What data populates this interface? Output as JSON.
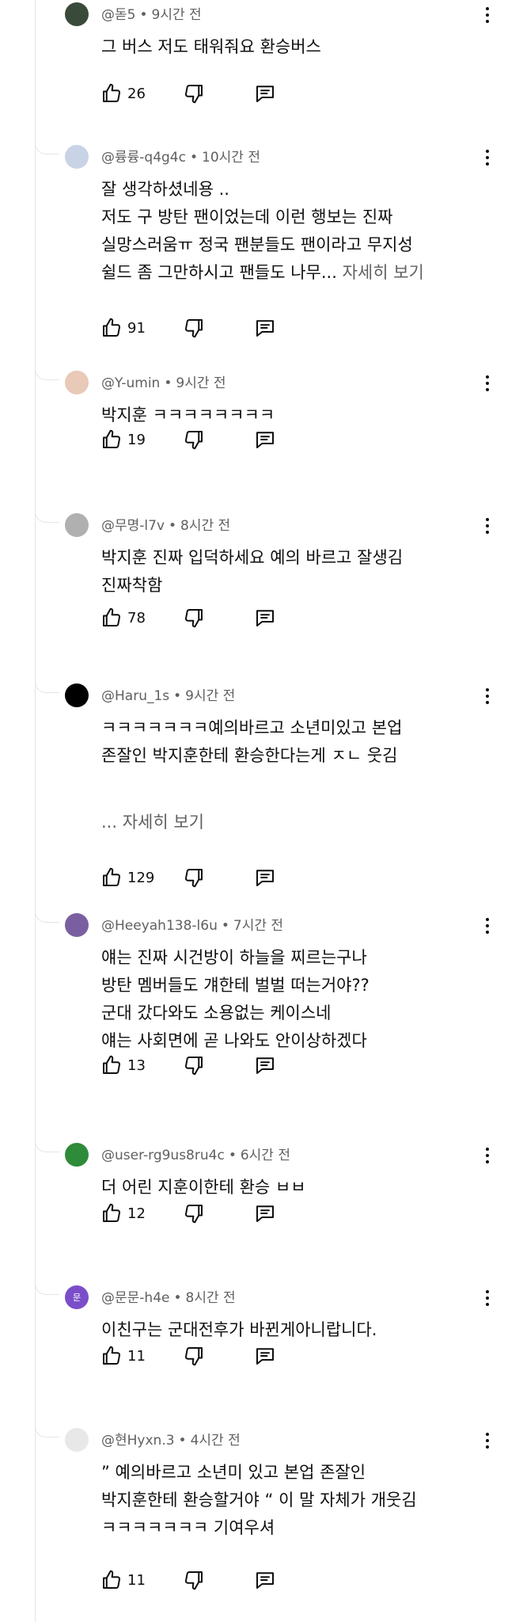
{
  "comments": [
    {
      "author": "@돋5",
      "time": "9시간 전",
      "lines": [
        "그 버스 저도 태워줘요 환승버스"
      ],
      "likes": "26",
      "avatar_color": "#3a4a3a"
    },
    {
      "author": "@륭륭-q4g4c",
      "time": "10시간 전",
      "lines": [
        "잘 생각하셨네용 ..",
        "저도 구 방탄 팬이었는데 이런 행보는 진짜",
        "실망스러움ㅠ 정국 팬분들도 팬이라고 무지성",
        "쉴드 좀 그만하시고 팬들도 나무..."
      ],
      "more": "자세히 보기",
      "likes": "91",
      "avatar_color": "#c9d3e6"
    },
    {
      "author": "@Y-umin",
      "time": "9시간 전",
      "lines": [
        "박지훈 ㅋㅋㅋㅋㅋㅋㅋㅋ"
      ],
      "likes": "19",
      "avatar_color": "#e9c9b8"
    },
    {
      "author": "@무명-l7v",
      "time": "8시간 전",
      "lines": [
        "박지훈 진짜 입덕하세요 예의 바르고 잘생김",
        "진짜착함"
      ],
      "likes": "78",
      "avatar_color": "#b0b0b0"
    },
    {
      "author": "@Haru_1s",
      "time": "9시간 전",
      "lines": [
        "ㅋㅋㅋㅋㅋㅋㅋ예의바르고 소년미있고 본업",
        "존잘인 박지훈한테 환승한다는게 ㅈㄴ 웃김"
      ],
      "more": "... 자세히 보기",
      "likes": "129",
      "avatar_color": "#000000"
    },
    {
      "author": "@Heeyah138-l6u",
      "time": "7시간 전",
      "lines": [
        "얘는 진짜 시건방이 하늘을 찌르는구나",
        "방탄 멤버들도 걔한테 벌벌 떠는거야??",
        "군대 갔다와도 소용없는 케이스네",
        "얘는 사회면에 곧 나와도 안이상하겠다"
      ],
      "likes": "13",
      "avatar_color": "#7a5fa0"
    },
    {
      "author": "@user-rg9us8ru4c",
      "time": "6시간 전",
      "lines": [
        "더 어린 지훈이한테 환승 ㅂㅂ"
      ],
      "likes": "12",
      "avatar_color": "#2e8b3a"
    },
    {
      "author": "@문문-h4e",
      "time": "8시간 전",
      "lines": [
        "이친구는 군대전후가 바뀐게아니랍니다."
      ],
      "likes": "11",
      "avatar_color": "#7b4ec9",
      "avatar_letter": "문"
    },
    {
      "author": "@현Hyxn.3",
      "time": "4시간 전",
      "lines": [
        "” 예의바르고 소년미 있고 본업 존잘인",
        "박지훈한테 환승할거야 “ 이 말 자체가 개웃김",
        "ㅋㅋㅋㅋㅋㅋㅋ 기여우셔"
      ],
      "likes": "11",
      "avatar_color": "#e8e8e8"
    }
  ],
  "colors": {
    "text": "#0f0f0f",
    "meta": "#606060",
    "thread": "#e5e5e5"
  },
  "icons": {
    "like": "thumb-up-icon",
    "dislike": "thumb-down-icon",
    "reply": "reply-icon",
    "menu": "more-vert-icon"
  }
}
